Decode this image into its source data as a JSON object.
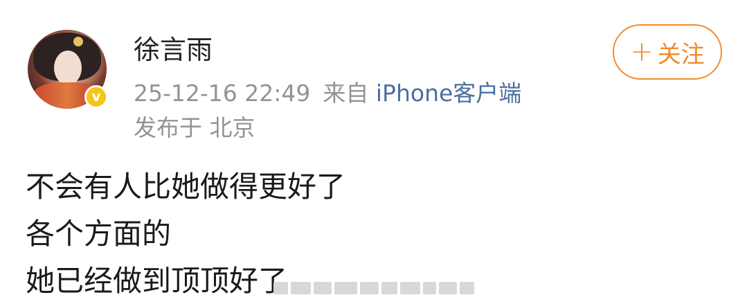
{
  "user": {
    "name": "徐言雨",
    "verified_badge": "v"
  },
  "meta": {
    "timestamp": "25-12-16 22:49",
    "from_label": "来自",
    "source": "iPhone客户端",
    "location": "发布于 北京"
  },
  "follow": {
    "plus": "+",
    "label": "关注"
  },
  "content": {
    "lines": [
      "不会有人比她做得更好了",
      "各个方面的",
      "她已经做到顶顶好了"
    ]
  },
  "colors": {
    "accent": "#f18b2a",
    "link": "#4a6f9f",
    "meta": "#939393",
    "badge": "#f6c516"
  }
}
